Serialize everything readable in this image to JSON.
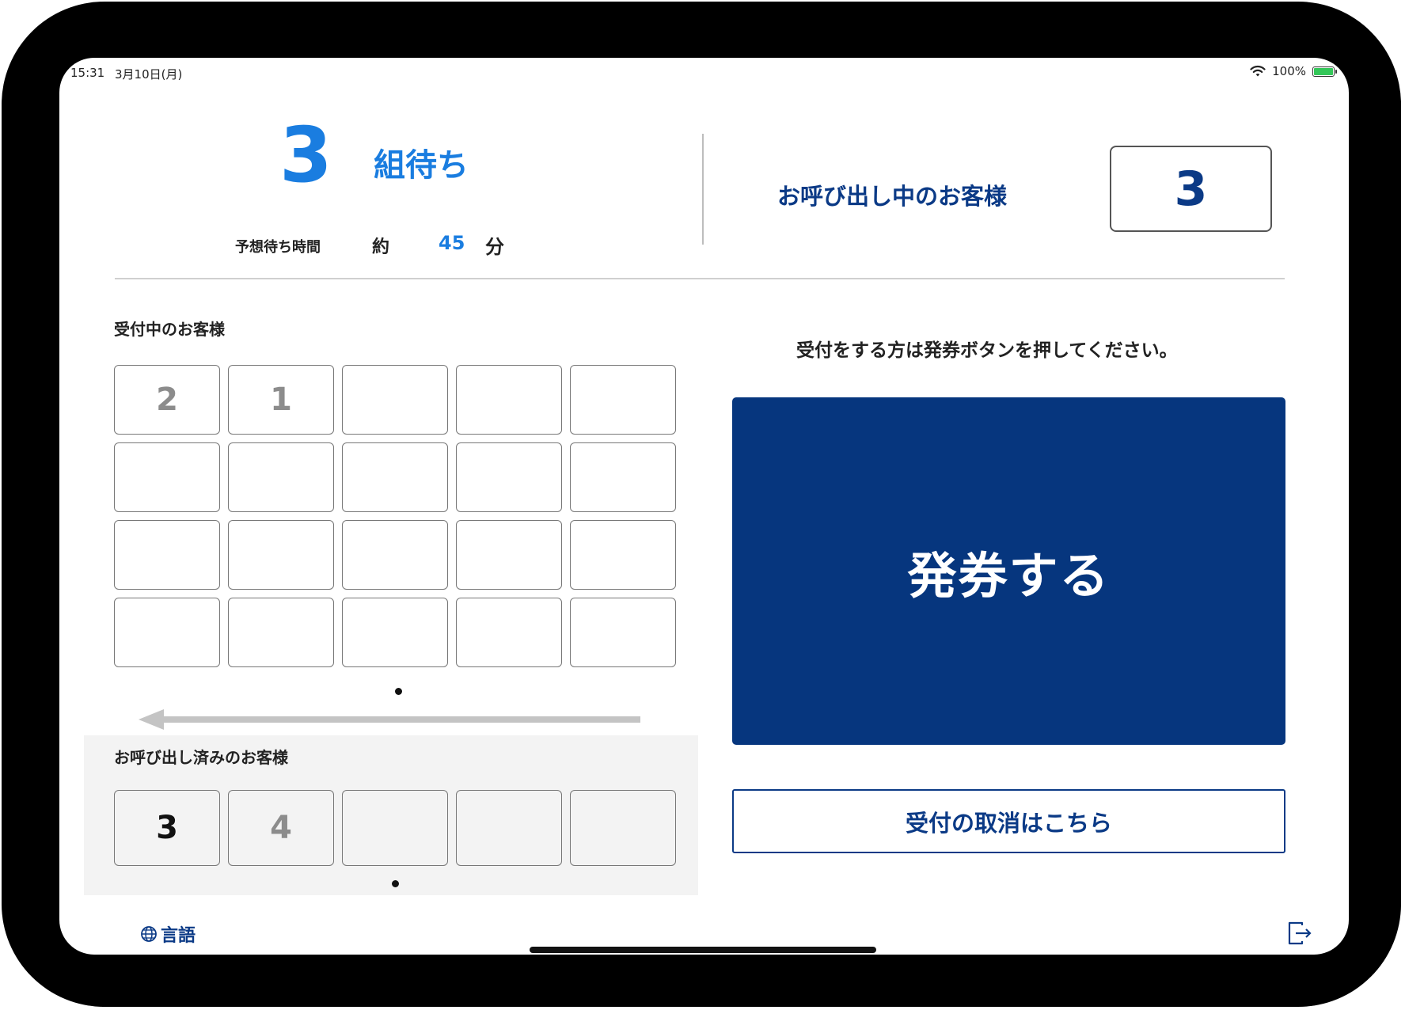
{
  "status_bar": {
    "time": "15:31",
    "date": "3月10日(月)",
    "battery": "100%",
    "wifi_icon": "wifi-icon",
    "battery_icon": "battery-icon"
  },
  "waiting": {
    "count": "3",
    "unit": "組待ち"
  },
  "estimate": {
    "label": "予想待ち時間",
    "approx": "約",
    "minutes": "45",
    "unit": "分"
  },
  "calling": {
    "label": "お呼び出し中のお客様",
    "number": "3"
  },
  "reception": {
    "label": "受付中のお客様",
    "cells": [
      "2",
      "1",
      "",
      "",
      "",
      "",
      "",
      "",
      "",
      "",
      "",
      "",
      "",
      "",
      "",
      "",
      "",
      "",
      "",
      ""
    ]
  },
  "called": {
    "label": "お呼び出し済みのお客様",
    "cells": [
      "3",
      "4",
      "",
      "",
      ""
    ]
  },
  "instruction": "受付をする方は発券ボタンを押してください。",
  "issue_button": "発券する",
  "cancel_button": "受付の取消はこちら",
  "language_button": "言語",
  "colors": {
    "accent": "#1a7de0",
    "brand": "#06367e",
    "text_navy": "#0b3a86"
  }
}
